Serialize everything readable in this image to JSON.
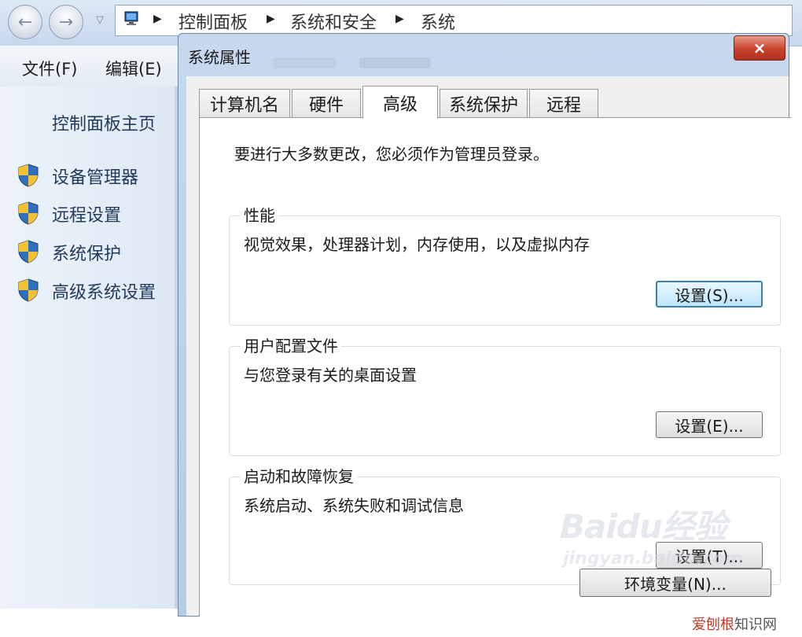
{
  "address_bar": {
    "crumbs": [
      "控制面板",
      "系统和安全",
      "系统"
    ]
  },
  "menu": {
    "file": "文件(F)",
    "edit": "编辑(E)"
  },
  "sidebar": {
    "home": "控制面板主页",
    "items": [
      {
        "label": "设备管理器",
        "icon": "uac-shield-icon"
      },
      {
        "label": "远程设置",
        "icon": "uac-shield-icon"
      },
      {
        "label": "系统保护",
        "icon": "uac-shield-icon"
      },
      {
        "label": "高级系统设置",
        "icon": "uac-shield-icon"
      }
    ]
  },
  "dialog": {
    "title": "系统属性",
    "close_glyph": "×",
    "tabs": [
      {
        "label": "计算机名",
        "active": false
      },
      {
        "label": "硬件",
        "active": false
      },
      {
        "label": "高级",
        "active": true
      },
      {
        "label": "系统保护",
        "active": false
      },
      {
        "label": "远程",
        "active": false
      }
    ],
    "admin_note": "要进行大多数更改，您必须作为管理员登录。",
    "groups": {
      "performance": {
        "title": "性能",
        "desc": "视觉效果，处理器计划，内存使用，以及虚拟内存",
        "button": "设置(S)..."
      },
      "user_profiles": {
        "title": "用户配置文件",
        "desc": "与您登录有关的桌面设置",
        "button": "设置(E)..."
      },
      "startup": {
        "title": "启动和故障恢复",
        "desc": "系统启动、系统失败和调试信息",
        "button": "设置(T)..."
      }
    },
    "env_button": "环境变量(N)..."
  },
  "watermark": {
    "logo": "Baidu经验",
    "url": "jingyan.baidu.com"
  },
  "corner_mark": {
    "part1": "爱刨根",
    "part2": "知识网"
  },
  "colors": {
    "title_bar": "#c8d9ee",
    "close_button": "#c8412b",
    "focus_border": "#3c7fb1"
  }
}
